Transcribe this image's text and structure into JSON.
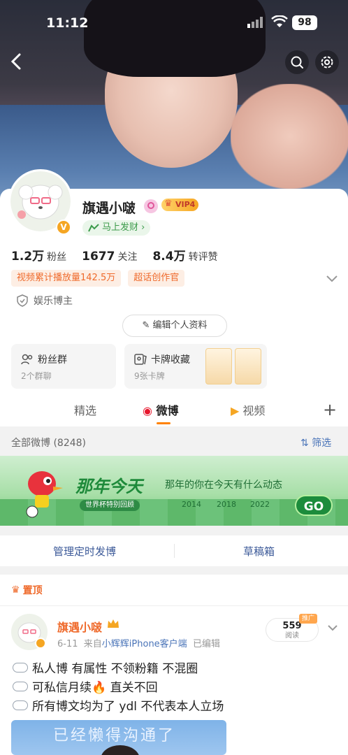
{
  "status_bar": {
    "time": "11:12",
    "battery": "98"
  },
  "profile": {
    "name": "旗遇小啵",
    "vip": "VIP4",
    "slogan": "马上发财",
    "stats": [
      {
        "num": "1.2万",
        "label": "粉丝"
      },
      {
        "num": "1677",
        "label": "关注"
      },
      {
        "num": "8.4万",
        "label": "转评赞"
      }
    ],
    "tags": [
      "视频累计播放量142.5万",
      "超话创作官"
    ],
    "blogger_type": "娱乐博主",
    "edit_button": "编辑个人资料"
  },
  "boxes": {
    "fan_group": {
      "title": "粉丝群",
      "sub": "2个群聊"
    },
    "card_collection": {
      "title": "卡牌收藏",
      "sub": "9张卡牌"
    }
  },
  "tabs": [
    "精选",
    "微博",
    "视频"
  ],
  "all_weibo": {
    "label": "全部微博 (8248)",
    "filter": "筛选"
  },
  "banner": {
    "title": "那年今天",
    "subtitle": "那年的你在今天有什么动态",
    "pill": "世界杯特别回顾",
    "years": [
      "2014",
      "2018",
      "2022"
    ],
    "go": "GO"
  },
  "actions": {
    "scheduled": "管理定时发博",
    "drafts": "草稿箱"
  },
  "post": {
    "pinned": "置顶",
    "author": "旗遇小啵",
    "date": "6-11",
    "source_prefix": "来自",
    "source": "小辉辉iPhone客户端",
    "edited": "已编辑",
    "reads_count": "559",
    "reads_label": "阅读",
    "promo": "推广",
    "lines": [
      "私人博 有属性 不领粉籍 不混圈",
      "可私信月续🔥 直关不回",
      "所有博文均为了 ydl 不代表本人立场"
    ],
    "image_text": "已经懒得沟通了"
  }
}
